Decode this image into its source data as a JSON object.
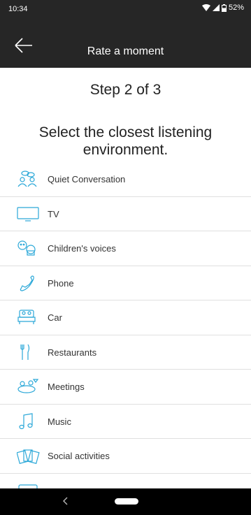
{
  "status_bar": {
    "time": "10:34",
    "battery": "52%"
  },
  "app_bar": {
    "title": "Rate a moment"
  },
  "step_text": "Step 2 of 3",
  "instruction": "Select the closest listening environment.",
  "environments": [
    {
      "label": "Quiet Conversation",
      "icon": "conversation-icon"
    },
    {
      "label": "TV",
      "icon": "tv-icon"
    },
    {
      "label": "Children's voices",
      "icon": "children-icon"
    },
    {
      "label": "Phone",
      "icon": "phone-icon"
    },
    {
      "label": "Car",
      "icon": "car-icon"
    },
    {
      "label": "Restaurants",
      "icon": "restaurant-icon"
    },
    {
      "label": "Meetings",
      "icon": "meetings-icon"
    },
    {
      "label": "Music",
      "icon": "music-icon"
    },
    {
      "label": "Social activities",
      "icon": "social-icon"
    },
    {
      "label": "",
      "icon": "partial-item-icon"
    }
  ],
  "colors": {
    "accent": "#2ba8d8",
    "bar": "#262626"
  }
}
